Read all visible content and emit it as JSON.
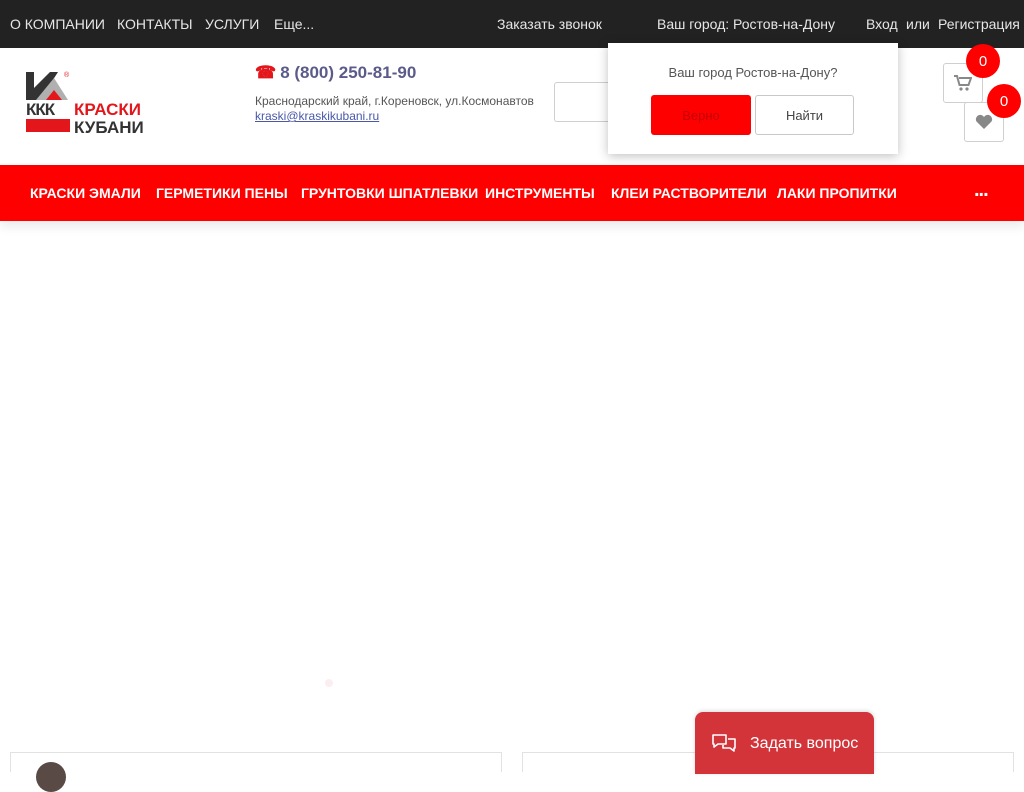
{
  "topbar": {
    "menu": [
      "О КОМПАНИИ",
      "КОНТАКТЫ",
      "УСЛУГИ",
      "Еще..."
    ],
    "callback": "Заказать звонок",
    "city": "Ваш город: Ростов-на-Дону",
    "login": "Вход",
    "or": "или",
    "register": "Регистрация"
  },
  "header": {
    "logo": {
      "kkk": "ККК",
      "line1": "КРАСКИ",
      "line2": "КУБАНИ",
      "reg": "®"
    },
    "phone": "8 (800) 250-81-90",
    "phone_icon": "phone-icon",
    "address": "Краснодарский край, г.Кореновск, ул.Космонавтов",
    "email": "kraski@kraskikubani.ru",
    "cart_count": "0",
    "favorites_count": "0"
  },
  "nav": {
    "items": [
      "КРАСКИ ЭМАЛИ",
      "ГЕРМЕТИКИ ПЕНЫ",
      "ГРУНТОВКИ ШПАТЛЕВКИ",
      "ИНСТРУМЕНТЫ",
      "КЛЕИ РАСТВОРИТЕЛИ",
      "ЛАКИ ПРОПИТКИ"
    ],
    "more": "..."
  },
  "city_popup": {
    "question": "Ваш город Ростов-на-Дону?",
    "yes": "Верно",
    "find": "Найти"
  },
  "chat": {
    "label": "Задать вопрос",
    "icon": "chat-icon"
  },
  "colors": {
    "accent": "#ff0000",
    "topbar": "#222222",
    "chat": "#d2343a"
  }
}
